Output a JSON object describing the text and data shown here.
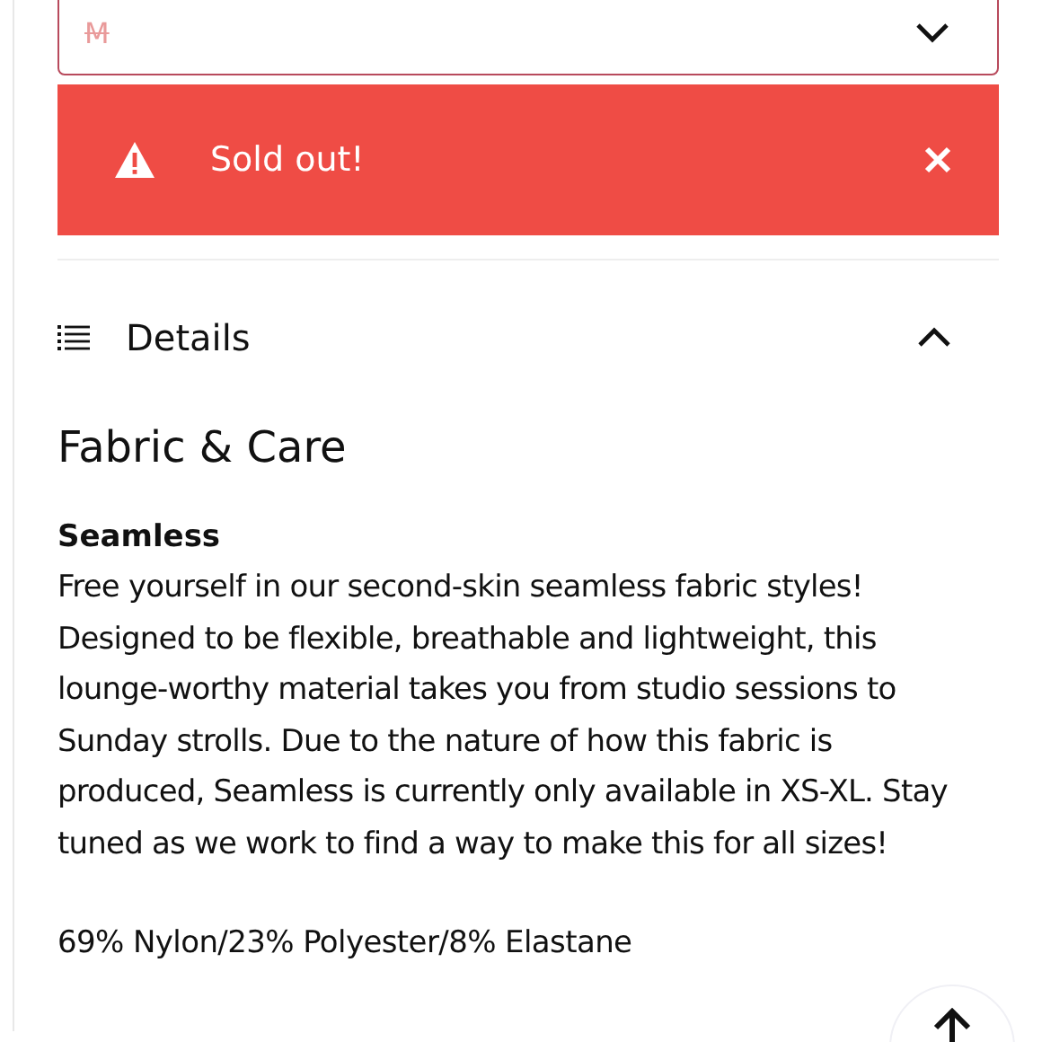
{
  "size_select": {
    "value": "M",
    "sold_out": true
  },
  "alert": {
    "kind": "error",
    "message": "Sold out!"
  },
  "details": {
    "title": "Details",
    "expanded": true,
    "section_title": "Fabric & Care",
    "product_name": "Seamless",
    "description": "Free yourself in our second-skin seamless fabric styles! Designed to be flexible, breathable and lightweight, this lounge-worthy material takes you from studio sessions to Sunday strolls. Due to the nature of how this fabric is produced, Seamless is currently only available in XS-XL. Stay tuned as we work to find a way to make this for all sizes!",
    "composition": "69% Nylon/23% Polyester/8% Elastane"
  }
}
